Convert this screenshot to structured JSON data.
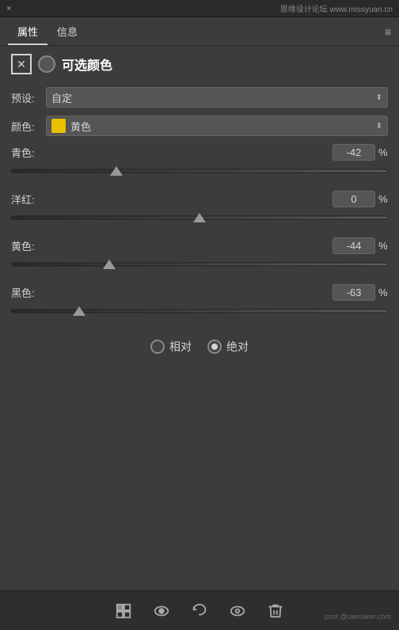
{
  "topbar": {
    "close_label": "×",
    "watermark": "思缘设计论坛 www.missyuan.cn"
  },
  "tabs": [
    {
      "id": "properties",
      "label": "属性",
      "active": true
    },
    {
      "id": "info",
      "label": "信息",
      "active": false
    }
  ],
  "tab_menu_icon": "≡",
  "panel": {
    "icon_box_symbol": "✕",
    "title": "可选颜色",
    "preset_label": "预设:",
    "preset_value": "自定",
    "color_label": "颜色:",
    "color_name": "黄色",
    "color_hex": "#e8c000",
    "sliders": [
      {
        "id": "cyan",
        "label": "青色:",
        "value": "-42",
        "thumb_pct": 28
      },
      {
        "id": "magenta",
        "label": "洋红:",
        "value": "0",
        "thumb_pct": 50
      },
      {
        "id": "yellow",
        "label": "黄色:",
        "value": "-44",
        "thumb_pct": 26
      },
      {
        "id": "black",
        "label": "黑色:",
        "value": "-63",
        "thumb_pct": 18
      }
    ],
    "percent": "%",
    "radio_options": [
      {
        "id": "relative",
        "label": "相对",
        "selected": false
      },
      {
        "id": "absolute",
        "label": "绝对",
        "selected": true
      }
    ]
  },
  "toolbar": {
    "buttons": [
      {
        "id": "mask",
        "icon": "mask"
      },
      {
        "id": "eye",
        "icon": "eye"
      },
      {
        "id": "undo",
        "icon": "undo"
      },
      {
        "id": "eye2",
        "icon": "eye2"
      },
      {
        "id": "trash",
        "icon": "trash"
      }
    ]
  },
  "watermark_bottom": "post @owmaker.com"
}
